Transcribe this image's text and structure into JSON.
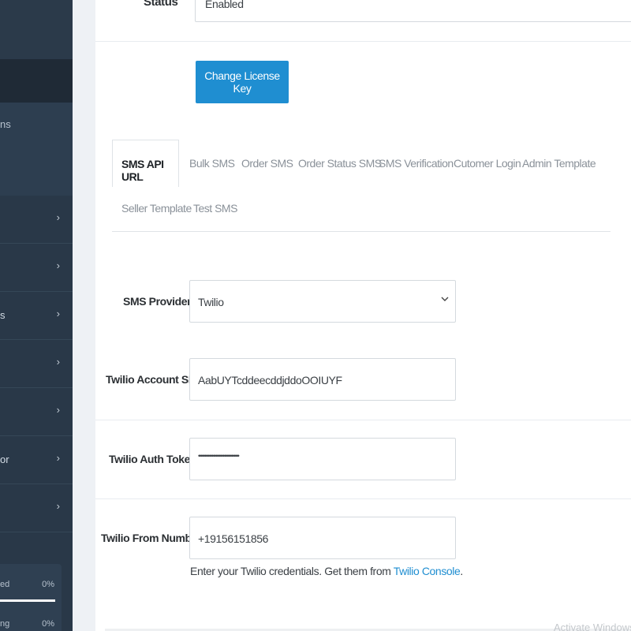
{
  "sidebar": {
    "submenu_text": "ns",
    "items": [
      {
        "label": "",
        "chevron": "›"
      },
      {
        "label": "",
        "chevron": "›"
      },
      {
        "label": "s",
        "chevron": "›"
      },
      {
        "label": "",
        "chevron": "›"
      },
      {
        "label": "",
        "chevron": "›"
      },
      {
        "label": "or",
        "chevron": "›"
      },
      {
        "label": "",
        "chevron": "›"
      }
    ],
    "progress": [
      {
        "label": "ed",
        "percent": "0%"
      },
      {
        "label": "ng",
        "percent": "0%"
      }
    ]
  },
  "status": {
    "label": "Status",
    "value": "Enabled"
  },
  "license_button": "Change License Key",
  "tabs": [
    "SMS API URL",
    "Bulk SMS",
    "Order SMS",
    "Order Status SMS",
    "SMS Verification",
    "Cutomer Login",
    "Admin Template",
    "Seller Template",
    "Test SMS"
  ],
  "form": {
    "provider": {
      "label": "SMS Provider",
      "value": "Twilio"
    },
    "account_sid": {
      "label": "Twilio Account SID",
      "value": "AabUYTcddeecddjddoOOIUYF"
    },
    "auth_token": {
      "label": "Twilio Auth Token",
      "value": "•••••••••••••••••••••••••••••••••"
    },
    "from_number": {
      "label": "Twilio From Number",
      "value": "+19156151856"
    }
  },
  "help": {
    "text": "Enter your Twilio credentials. Get them from",
    "link": "Twilio Console",
    "suffix": "."
  },
  "watermark": "Activate Windows"
}
